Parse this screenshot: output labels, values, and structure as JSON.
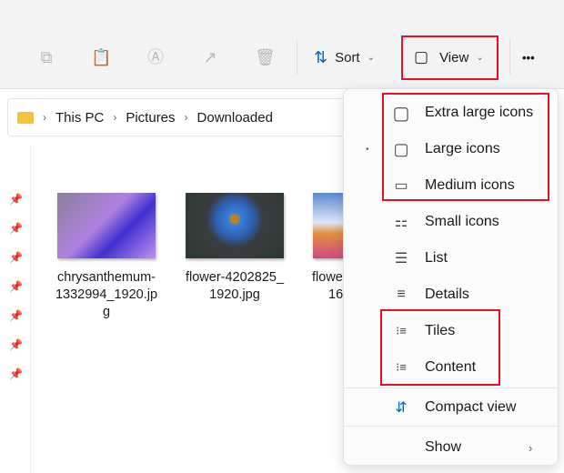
{
  "toolbar": {
    "sort": "Sort",
    "view": "View",
    "more": "•••"
  },
  "breadcrumb": [
    "This PC",
    "Pictures",
    "Downloaded"
  ],
  "files": [
    {
      "name": "chrysanthemum-1332994_1920.jpg",
      "line1": "chrysanthemum-",
      "line2": "1332994_1920.jp",
      "line3": "g"
    },
    {
      "name": "flower-4202825_1920.jpg",
      "line1": "flower-4202825_",
      "line2": "1920.jpg",
      "line3": ""
    },
    {
      "name": "flowe...",
      "line1": "flowe",
      "line2": "16",
      "line3": ""
    }
  ],
  "menu": {
    "items": [
      {
        "label": "Extra large icons",
        "icon": "▢"
      },
      {
        "label": "Large icons",
        "icon": "▢",
        "selected": true
      },
      {
        "label": "Medium icons",
        "icon": "▭"
      },
      {
        "label": "Small icons",
        "icon": "⚏"
      },
      {
        "label": "List",
        "icon": "☰"
      },
      {
        "label": "Details",
        "icon": "≡"
      },
      {
        "label": "Tiles",
        "icon": "⁝≡"
      },
      {
        "label": "Content",
        "icon": "⁝≡"
      }
    ],
    "compact": "Compact view",
    "show": "Show",
    "selected_marker": "•"
  },
  "colors": {
    "highlight": "#e81123",
    "accent": "#0067c0"
  }
}
